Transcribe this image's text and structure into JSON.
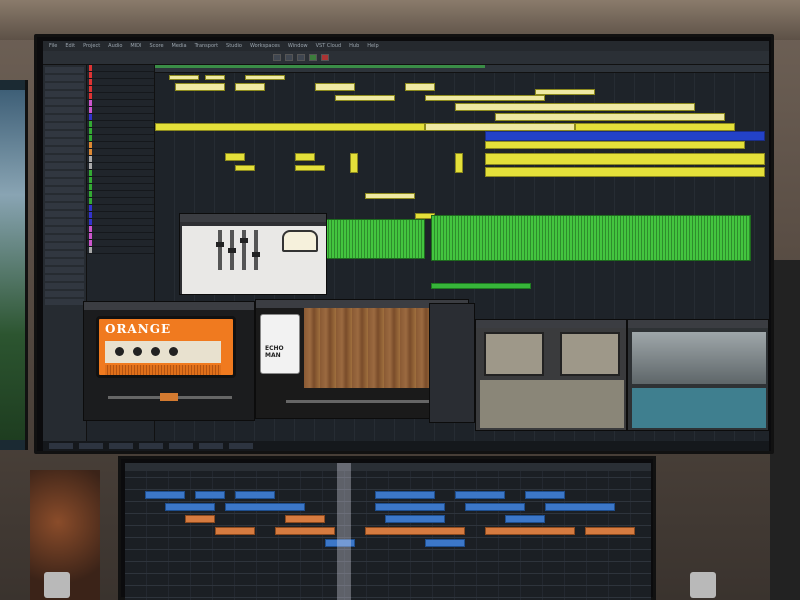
{
  "scene": {
    "description_tags": [
      "daw-arrangement",
      "guitar-amp-plugin",
      "delay-pedal-plugin",
      "tape-plugin",
      "room-reverb-plugin"
    ]
  },
  "daw": {
    "menu": [
      "File",
      "Edit",
      "Project",
      "Audio",
      "MIDI",
      "Score",
      "Media",
      "Transport",
      "Studio",
      "Workspaces",
      "Window",
      "VST Cloud",
      "Hub",
      "Help"
    ],
    "transport": {
      "time_display": ""
    }
  },
  "plugins": {
    "amp": {
      "logo": "ORANGE"
    },
    "pedal": {
      "name_line1": "ECHO",
      "name_line2": "MAN"
    }
  },
  "colors": {
    "clip_yellow": "#e4e03a",
    "clip_blue": "#2342c8",
    "clip_green": "#37b53a",
    "clip_orange": "#e2874b",
    "clip_lightblue": "#3c77c8",
    "amp_orange": "#f07a1f"
  }
}
